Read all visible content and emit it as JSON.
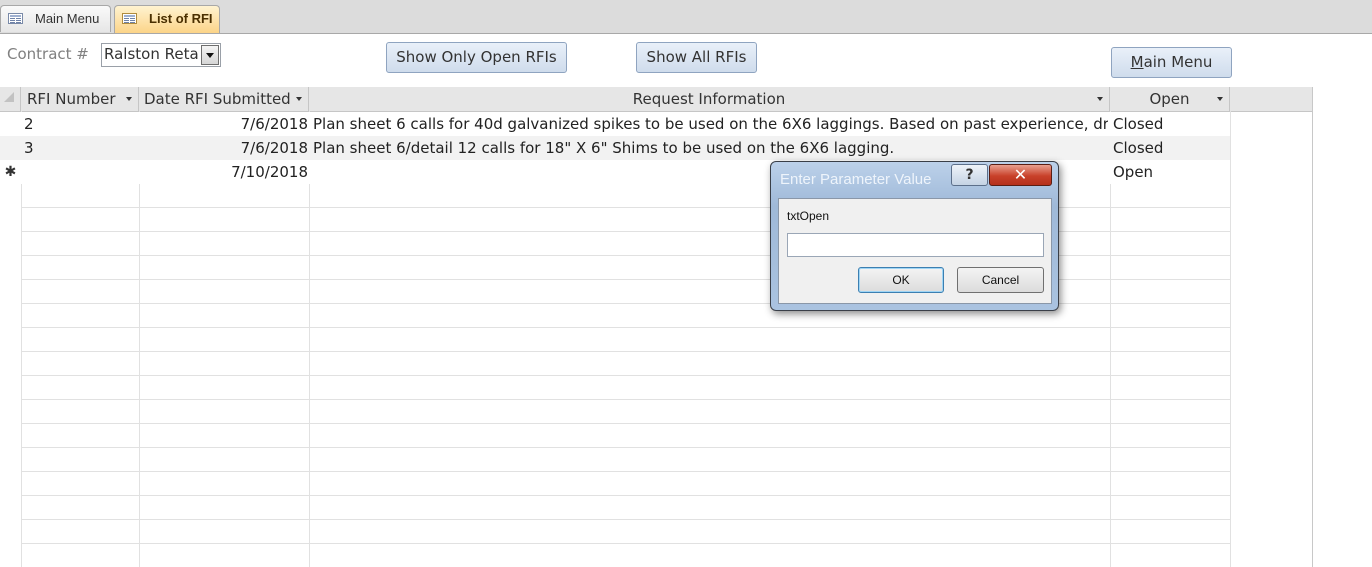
{
  "tabs": [
    {
      "label": "Main Menu"
    },
    {
      "label": "List of RFI"
    }
  ],
  "form": {
    "contract_label": "Contract #",
    "contract_value": "Ralston Retai",
    "show_open_label": "Show Only Open RFIs",
    "show_all_label": "Show All RFIs",
    "main_menu_label": "Main Menu",
    "main_menu_hotkey": "M",
    "main_menu_rest": "ain Menu"
  },
  "table": {
    "columns": [
      "RFI Number",
      "Date RFI Submitted",
      "Request Information",
      "Open"
    ],
    "rows": [
      {
        "selector": "",
        "rfi_number": "2",
        "date": "7/6/2018",
        "request": "Plan sheet 6 calls for 40d galvanized spikes to be used on the 6X6 laggings. Based on past experience, driving a",
        "open": "Closed"
      },
      {
        "selector": "",
        "rfi_number": "3",
        "date": "7/6/2018",
        "request": "Plan sheet 6/detail 12 calls for 18\" X 6\" Shims to be used on the 6X6 lagging.",
        "open": "Closed"
      },
      {
        "selector": "✱",
        "rfi_number": "",
        "date": "7/10/2018",
        "request": "",
        "open": "Open"
      }
    ]
  },
  "dialog": {
    "title": "Enter Parameter Value",
    "help_glyph": "?",
    "close_glyph": "✕",
    "prompt": "txtOpen",
    "input_value": "",
    "ok_label": "OK",
    "cancel_label": "Cancel"
  }
}
